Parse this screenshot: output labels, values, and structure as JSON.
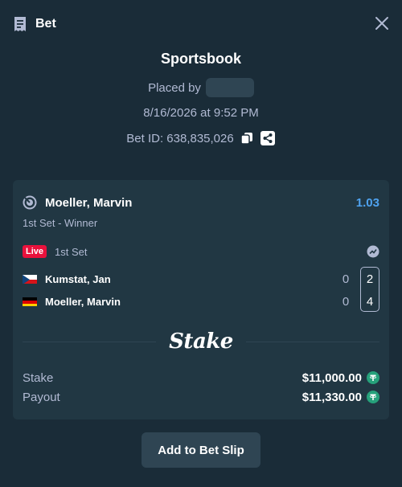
{
  "header": {
    "title": "Bet"
  },
  "bet": {
    "source": "Sportsbook",
    "placed_by_label": "Placed by",
    "date": "8/16/2026 at 9:52 PM",
    "bet_id": "Bet ID: 638,835,026"
  },
  "selection": {
    "name": "Moeller, Marvin",
    "odds": "1.03",
    "market": "1st Set - Winner",
    "live_label": "Live",
    "period": "1st Set"
  },
  "players": [
    {
      "name": "Kumstat, Jan",
      "flag": "czech-flag",
      "sets": "0",
      "games": "2"
    },
    {
      "name": "Moeller, Marvin",
      "flag": "germany-flag",
      "sets": "0",
      "games": "4"
    }
  ],
  "logo": "Stake",
  "totals": {
    "stake_label": "Stake",
    "stake_value": "$11,000.00",
    "payout_label": "Payout",
    "payout_value": "$11,330.00",
    "currency_icon": "tether-icon"
  },
  "actions": {
    "add_to_slip": "Add to Bet Slip"
  },
  "colors": {
    "background": "#1a2c38",
    "card": "#213743",
    "odds": "#4fa3f0",
    "live": "#e9113c",
    "tether": "#26a17b"
  }
}
